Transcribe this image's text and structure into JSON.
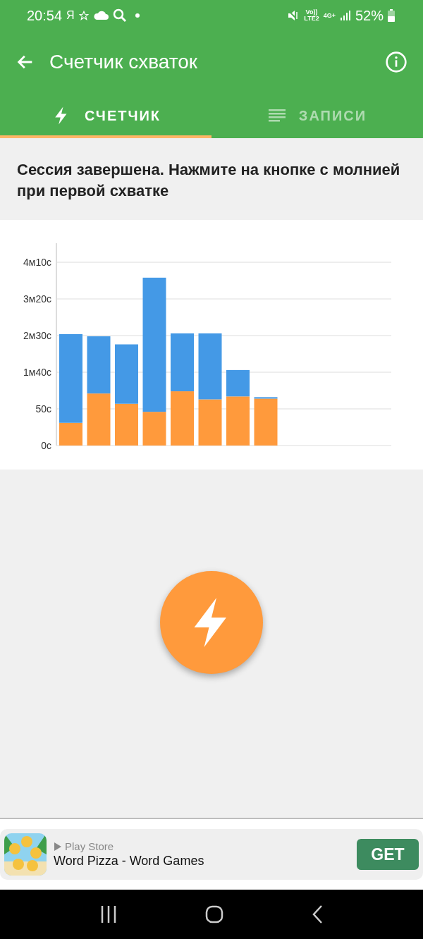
{
  "status_bar": {
    "time": "20:54",
    "app_glyph": "Я",
    "network_labels": [
      "Vo))",
      "LTE2",
      "4G+"
    ],
    "battery": "52%"
  },
  "app_bar": {
    "title": "Счетчик схваток"
  },
  "tabs": [
    {
      "label": "СЧЕТЧИК",
      "kind": "bolt",
      "selected": true
    },
    {
      "label": "ЗАПИСИ",
      "kind": "list",
      "selected": false
    }
  ],
  "message": "Сессия завершена. Нажмите на кнопке с молнией при первой схватке",
  "chart": {
    "chart_data": {
      "type": "bar",
      "stacked": true,
      "grid": true,
      "ylim": [
        0,
        276
      ],
      "yticks": [
        {
          "value": 0,
          "label": "0с"
        },
        {
          "value": 50,
          "label": "50с"
        },
        {
          "value": 100,
          "label": "1м40с"
        },
        {
          "value": 150,
          "label": "2м30с"
        },
        {
          "value": 200,
          "label": "3м20с"
        },
        {
          "value": 250,
          "label": "4м10с"
        }
      ],
      "series": [
        {
          "color": "#ff9a3c",
          "values": [
            31,
            71,
            57,
            46,
            74,
            63,
            67,
            64
          ]
        },
        {
          "color": "#4499e6",
          "values": [
            121,
            78,
            81,
            183,
            79,
            90,
            36,
            2
          ]
        }
      ]
    }
  },
  "ad": {
    "source": "Play Store",
    "title": "Word Pizza - Word Games",
    "button": "GET"
  }
}
